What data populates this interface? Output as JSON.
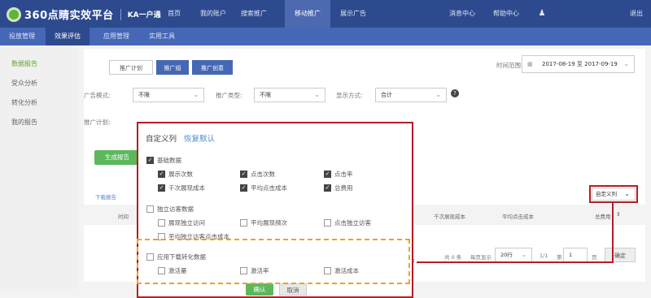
{
  "topbar": {
    "logo_text": "360点睛实效平台",
    "logo_sub": "KA一户通",
    "nav": [
      "首页",
      "我的账户",
      "搜索推广",
      "移动推广",
      "展示广告"
    ],
    "active_nav": "移动推广",
    "right": [
      "消息中心",
      "帮助中心",
      "退出"
    ]
  },
  "subnav": [
    "投放管理",
    "效果评估",
    "应用管理",
    "实用工具"
  ],
  "sidebar": [
    "数据报告",
    "受众分析",
    "转化分析",
    "我的报告"
  ],
  "tabs": [
    "推广计划",
    "推广组",
    "推广创意"
  ],
  "date_range": {
    "label": "时间范围:",
    "start": "2017-08-19",
    "sep": "至",
    "end": "2017-09-19"
  },
  "filters": {
    "ad_mode_label": "广告模式:",
    "ad_mode_value": "不限",
    "promo_type_label": "推广类型:",
    "promo_type_value": "不限",
    "display_label": "显示方式:",
    "display_value": "合计",
    "plan_label": "推广计划:"
  },
  "generate_report": "生成报告",
  "download_report": "下载报告",
  "custom_columns_select": "自定义列",
  "table_headers": [
    "时间",
    "千次展现成本",
    "平均点击成本",
    "总费用"
  ],
  "pagination": {
    "total": "共 0 条",
    "per_page_label": "每页显示",
    "per_page_value": "20行",
    "page_info": "1/1",
    "goto_label": "第",
    "goto_value": "1",
    "page_unit": "页",
    "confirm": "确定"
  },
  "modal": {
    "title": "自定义列",
    "reset": "恢复默认",
    "groups": [
      {
        "label": "基础数据",
        "checked": true,
        "items": [
          {
            "label": "展示次数",
            "checked": true
          },
          {
            "label": "点击次数",
            "checked": true
          },
          {
            "label": "点击率",
            "checked": true
          },
          {
            "label": "千次展现成本",
            "checked": true
          },
          {
            "label": "平均点击成本",
            "checked": true
          },
          {
            "label": "总费用",
            "checked": true
          }
        ]
      },
      {
        "label": "独立访客数据",
        "checked": false,
        "items": [
          {
            "label": "展现独立访问",
            "checked": false
          },
          {
            "label": "平均展现频次",
            "checked": false
          },
          {
            "label": "点击独立访客",
            "checked": false
          },
          {
            "label": "平均独立访客点击成本",
            "checked": false
          }
        ]
      },
      {
        "label": "应用下载转化数据",
        "checked": false,
        "items": [
          {
            "label": "激活量",
            "checked": false
          },
          {
            "label": "激活率",
            "checked": false
          },
          {
            "label": "激活成本",
            "checked": false
          }
        ]
      }
    ],
    "ok": "确认",
    "cancel": "取消"
  },
  "colors": {
    "topbar": "#2d4a8e",
    "subbar": "#4567b5",
    "green": "#5cb85c",
    "highlight_red": "#b51c25",
    "highlight_orange": "#f0a31c"
  }
}
